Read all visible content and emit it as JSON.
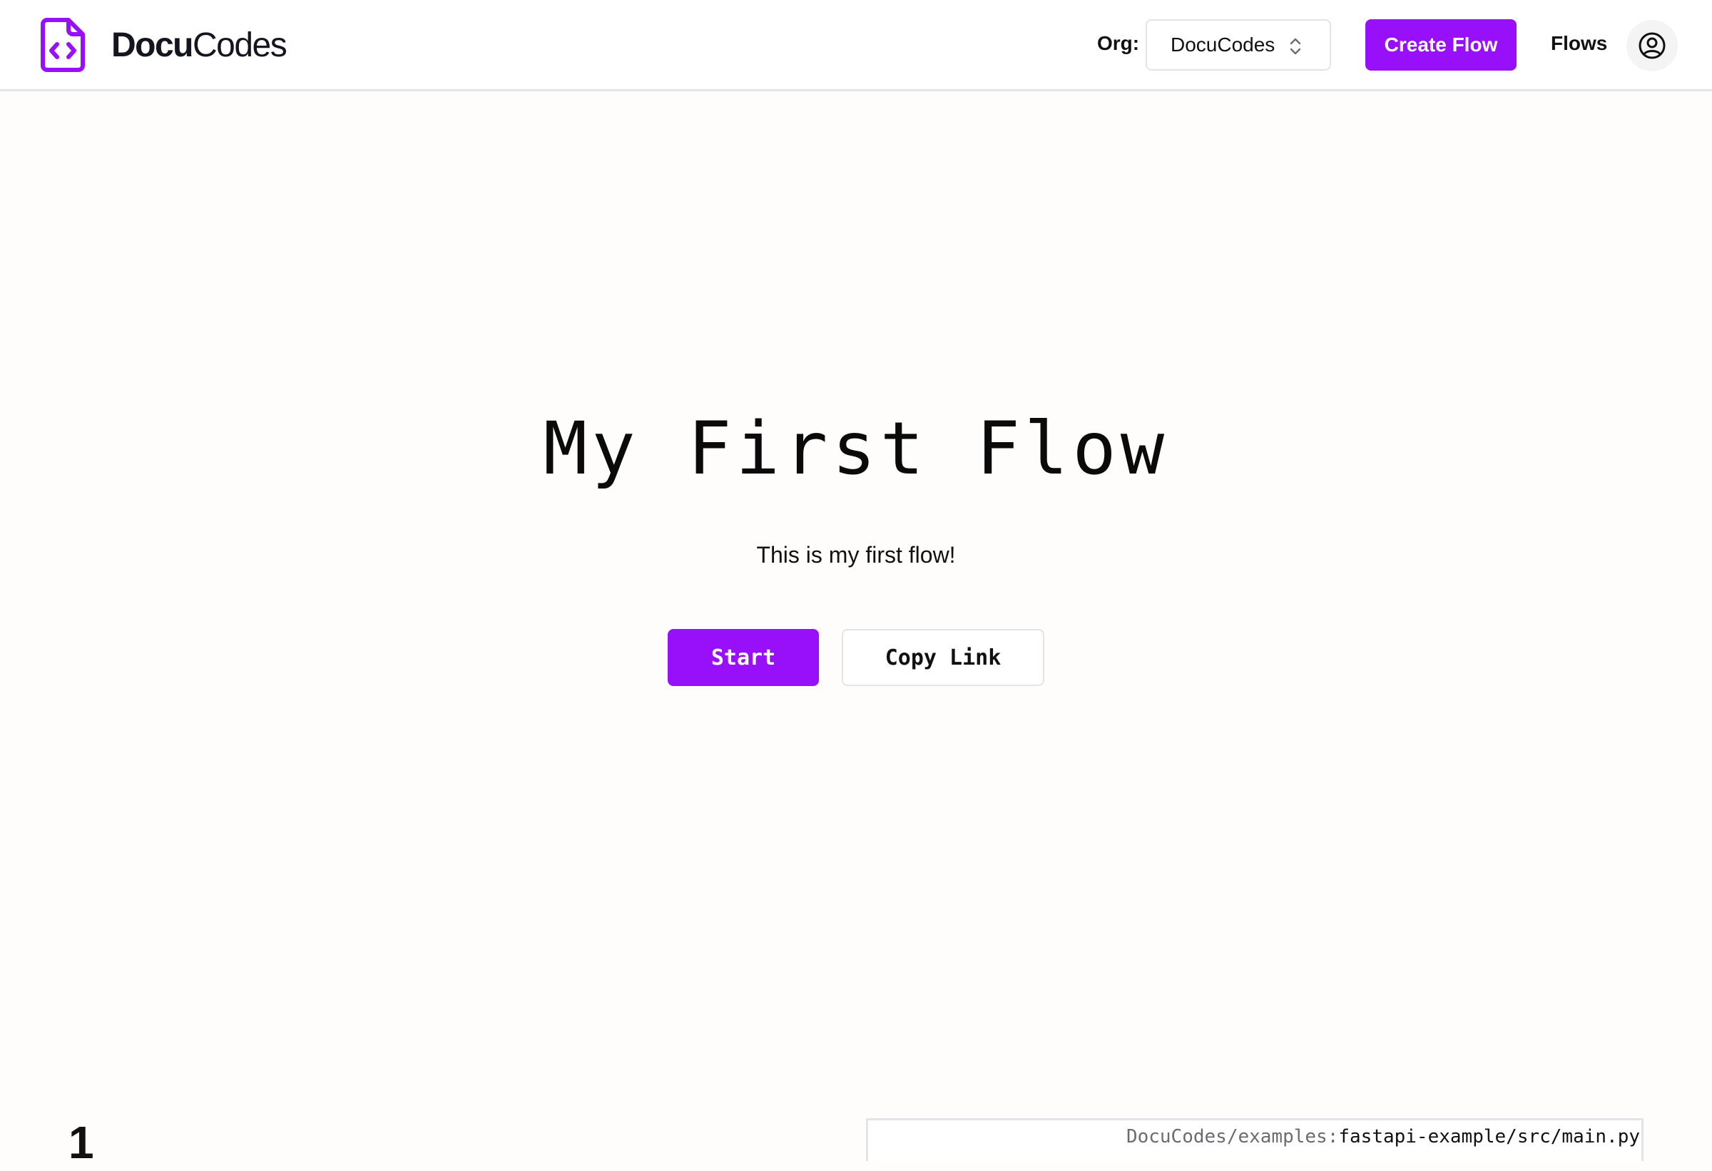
{
  "header": {
    "brand": {
      "name_bold": "Docu",
      "name_regular": "Codes",
      "icon": "file-code-icon"
    },
    "org": {
      "label": "Org:",
      "selected": "DocuCodes",
      "icon": "chevron-up-down-icon"
    },
    "create_flow_label": "Create Flow",
    "flows_label": "Flows",
    "avatar_icon": "user-circle-icon"
  },
  "main": {
    "title": "My First Flow",
    "description": "This is my first flow!",
    "start_label": "Start",
    "copy_link_label": "Copy Link"
  },
  "step": {
    "number": "1",
    "file": {
      "repo": "DocuCodes/examples:",
      "path": "fastapi-example/src/main.py"
    }
  },
  "colors": {
    "accent": "#9810fa",
    "background": "#fefdfc",
    "border": "#e4e4e7",
    "text": "#111111"
  }
}
